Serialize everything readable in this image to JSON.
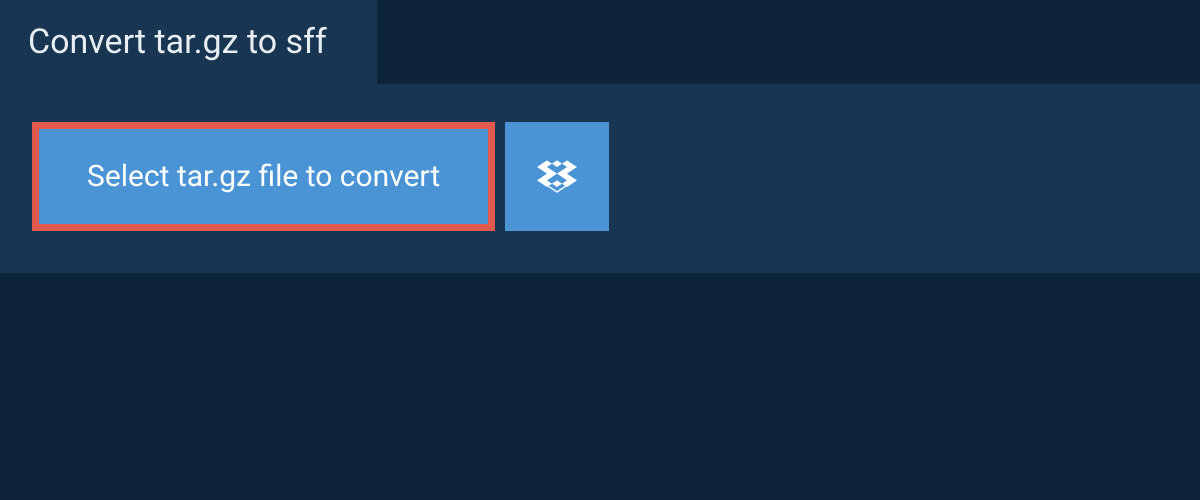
{
  "header": {
    "title": "Convert tar.gz to sff"
  },
  "main": {
    "select_button_label": "Select tar.gz file to convert"
  }
}
